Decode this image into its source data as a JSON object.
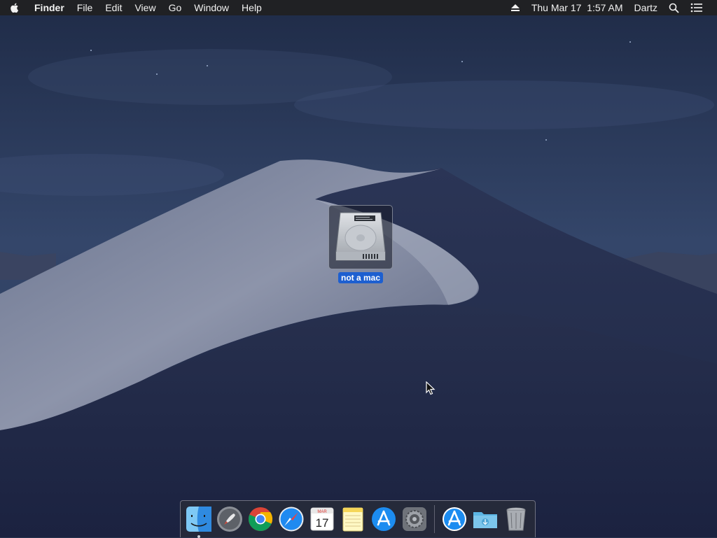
{
  "menubar": {
    "app_name": "Finder",
    "menus": [
      "File",
      "Edit",
      "View",
      "Go",
      "Window",
      "Help"
    ],
    "clock": "Thu Mar 17  1:57 AM",
    "user": "Dartz"
  },
  "desktop": {
    "icons": [
      {
        "label": "not a mac",
        "icon": "hard-drive-icon",
        "selected": true
      }
    ]
  },
  "dock": {
    "apps": [
      {
        "name": "Finder",
        "icon": "finder-icon",
        "running": true
      },
      {
        "name": "Launchpad",
        "icon": "launchpad-icon",
        "running": false
      },
      {
        "name": "Google Chrome",
        "icon": "chrome-icon",
        "running": false
      },
      {
        "name": "Safari",
        "icon": "safari-icon",
        "running": false
      },
      {
        "name": "Calendar",
        "icon": "calendar-icon",
        "running": false,
        "month": "MAR",
        "day": "17"
      },
      {
        "name": "Notes",
        "icon": "notes-icon",
        "running": false
      },
      {
        "name": "App Store",
        "icon": "app-store-icon",
        "running": false
      },
      {
        "name": "System Preferences",
        "icon": "system-preferences-icon",
        "running": false
      }
    ],
    "right_items": [
      {
        "name": "Applications",
        "icon": "app-store-stack-icon"
      },
      {
        "name": "Downloads",
        "icon": "downloads-folder-icon"
      },
      {
        "name": "Trash",
        "icon": "trash-icon"
      }
    ]
  },
  "colors": {
    "menubar_bg": "#202124",
    "selection_blue": "#1d5fd0",
    "wallpaper_sky": "#2c3a5a"
  }
}
